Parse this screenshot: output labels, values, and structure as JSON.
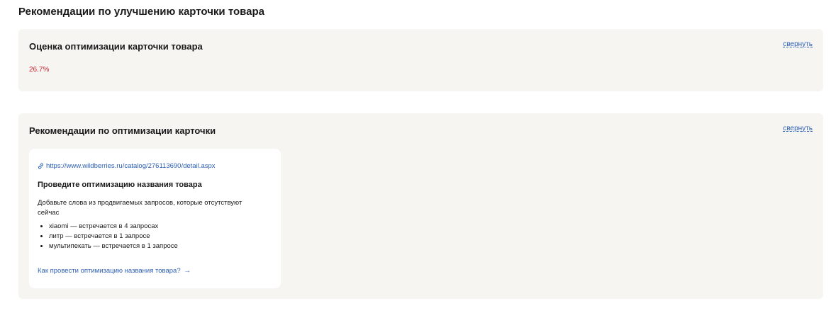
{
  "page": {
    "title": "Рекомендации по улучшению карточки товара"
  },
  "score_panel": {
    "heading": "Оценка оптимизации карточки товара",
    "collapse_label": "свернуть",
    "score": "26.7%",
    "score_color": "#c8232c"
  },
  "recs_panel": {
    "heading": "Рекомендации по оптимизации карточки",
    "collapse_label": "свернуть",
    "card": {
      "link_icon": "link-icon",
      "url": "https://www.wildberries.ru/catalog/276113690/detail.aspx",
      "title": "Проведите оптимизацию названия товара",
      "description": "Добавьте слова из продвигаемых запросов, которые отсутствуют сейчас",
      "items": [
        "xiaomi — встречается в 4 запросах",
        "литр — встречается в 1 запросе",
        "мультипекать — встречается в 1 запросе"
      ],
      "help_link": "Как провести оптимизацию названия товара?",
      "help_arrow": "→"
    }
  },
  "colors": {
    "panel_bg": "#f7f5f2",
    "link": "#2b5fb4",
    "accent_red": "#c8232c"
  }
}
